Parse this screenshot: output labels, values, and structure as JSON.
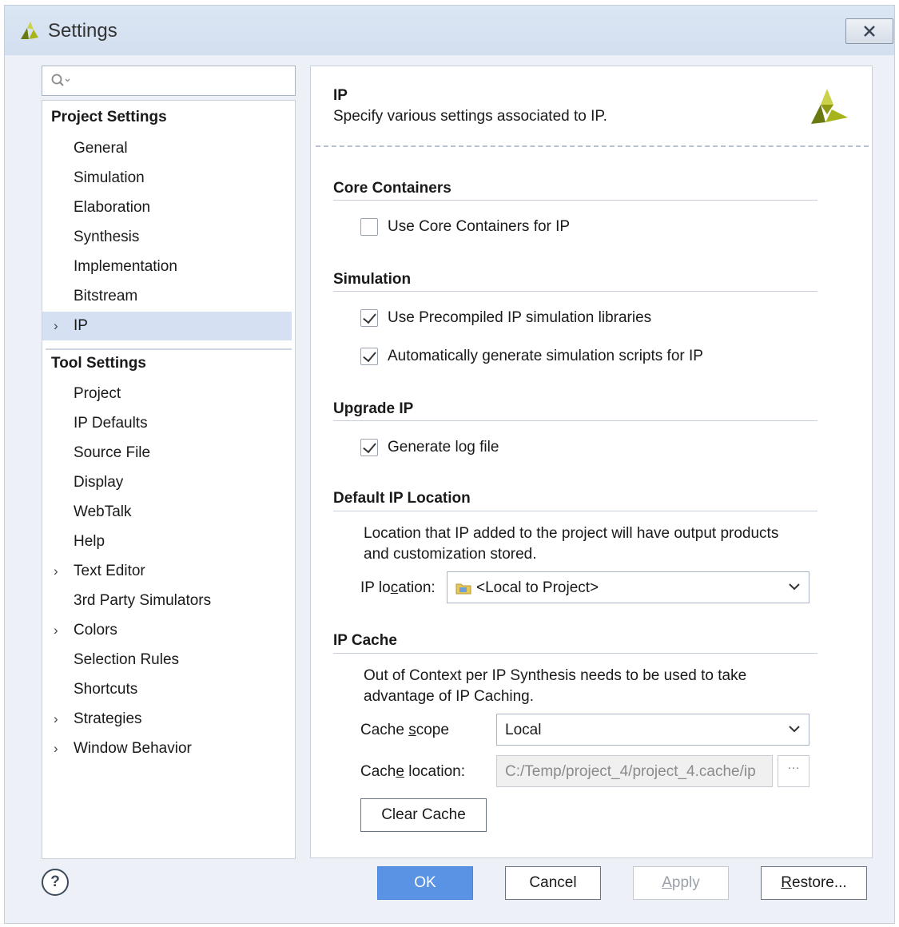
{
  "window": {
    "title": "Settings"
  },
  "search": {
    "placeholder": ""
  },
  "nav": {
    "project_heading": "Project Settings",
    "project_items": [
      {
        "label": "General"
      },
      {
        "label": "Simulation"
      },
      {
        "label": "Elaboration"
      },
      {
        "label": "Synthesis"
      },
      {
        "label": "Implementation"
      },
      {
        "label": "Bitstream"
      },
      {
        "label": "IP",
        "chevron": "›",
        "selected": true
      }
    ],
    "tool_heading": "Tool Settings",
    "tool_items": [
      {
        "label": "Project"
      },
      {
        "label": "IP Defaults"
      },
      {
        "label": "Source File"
      },
      {
        "label": "Display"
      },
      {
        "label": "WebTalk"
      },
      {
        "label": "Help"
      },
      {
        "label": "Text Editor",
        "chevron": "›"
      },
      {
        "label": "3rd Party Simulators"
      },
      {
        "label": "Colors",
        "chevron": "›"
      },
      {
        "label": "Selection Rules"
      },
      {
        "label": "Shortcuts"
      },
      {
        "label": "Strategies",
        "chevron": "›"
      },
      {
        "label": "Window Behavior",
        "chevron": "›"
      }
    ]
  },
  "content": {
    "title": "IP",
    "description": "Specify various settings associated to IP.",
    "core_containers": {
      "heading": "Core Containers",
      "use_core_containers": {
        "label": "Use Core Containers for IP",
        "checked": false
      }
    },
    "simulation": {
      "heading": "Simulation",
      "use_precompiled": {
        "label": "Use Precompiled IP simulation libraries",
        "checked": true
      },
      "auto_generate": {
        "label": "Automatically generate simulation scripts for IP",
        "checked": true
      }
    },
    "upgrade_ip": {
      "heading": "Upgrade IP",
      "generate_log": {
        "label": "Generate log file",
        "checked": true
      }
    },
    "default_ip_location": {
      "heading": "Default IP Location",
      "note_line1": "Location that IP added to the project will have output products",
      "note_line2": "and customization stored.",
      "label_pre": "IP lo",
      "label_u": "c",
      "label_post": "ation:",
      "value": "<Local to Project>"
    },
    "ip_cache": {
      "heading": "IP Cache",
      "note_line1": "Out of Context per IP Synthesis needs to be used to take",
      "note_line2": "advantage of IP Caching.",
      "scope_label_pre": "Cache ",
      "scope_label_u": "s",
      "scope_label_post": "cope",
      "scope_value": "Local",
      "location_label_pre": "Cach",
      "location_label_u": "e",
      "location_label_post": " location:",
      "location_value": "C:/Temp/project_4/project_4.cache/ip",
      "browse_label": "···",
      "clear_button": "Clear Cache"
    }
  },
  "footer": {
    "help_label": "?",
    "ok": "OK",
    "cancel": "Cancel",
    "apply_u": "A",
    "apply_rest": "pply",
    "restore_u": "R",
    "restore_rest": "estore..."
  },
  "colors": {
    "accent": "#5b93e4",
    "selected_bg": "#d5e1f2",
    "logo": "#a8b41c"
  }
}
